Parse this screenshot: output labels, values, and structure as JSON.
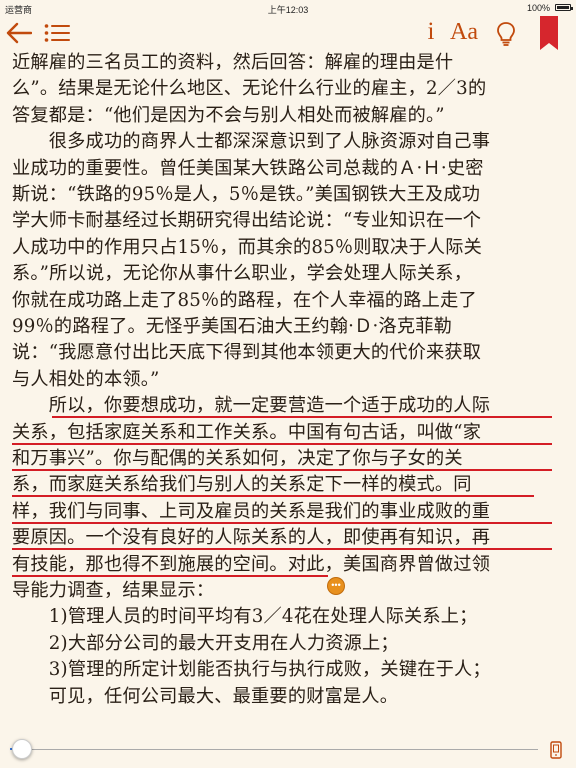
{
  "status_bar": {
    "carrier": "运营商",
    "time": "上午12:03",
    "battery": "100%"
  },
  "toolbar": {
    "info_label": "i",
    "font_label": "Aa"
  },
  "reading": {
    "progress": 0.02,
    "note_label": "•••",
    "lines": [
      "近解雇的三名员工的资料，然后回答：解雇的理由是什",
      "么”。结果是无论什么地区、无论什么行业的雇主，2／3的",
      "答复都是：“他们是因为不会与别人相处而被解雇的。”",
      "　　很多成功的商界人士都深深意识到了人脉资源对自己事",
      "业成功的重要性。曾任美国某大铁路公司总裁的Ａ·Ｈ·史密",
      "斯说：“铁路的95％是人，5％是铁。”美国钢铁大王及成功",
      "学大师卡耐基经过长期研究得出结论说：“专业知识在一个",
      "人成功中的作用只占15％，而其余的85％则取决于人际关",
      "系。”所以说，无论你从事什么职业，学会处理人际关系，",
      "你就在成功路上走了85％的路程，在个人幸福的路上走了",
      "99％的路程了。无怪乎美国石油大王约翰·Ｄ·洛克菲勒",
      "说：“我愿意付出比天底下得到其他本领更大的代价来获取",
      "与人相处的本领。”",
      "　　所以，你要想成功，就一定要营造一个适于成功的人际",
      "关系，包括家庭关系和工作关系。中国有句古话，叫做“家",
      "和万事兴”。你与配偶的关系如何，决定了你与子女的关",
      "系，而家庭关系给我们与别人的关系定下一样的模式。同",
      "样，我们与同事、上司及雇员的关系是我们的事业成败的重",
      "要原因。一个没有良好的人际关系的人，即使再有知识，再",
      "有技能，那也得不到施展的空间。对此，美国商界曾做过领",
      "导能力调查，结果显示：",
      "　　1)管理人员的时间平均有3／4花在处理人际关系上；",
      "　　2)大部分公司的最大开支用在人力资源上；",
      "　　3)管理的所定计划能否执行与执行成败，关键在于人；",
      "　　可见，任何公司最大、最重要的财富是人。"
    ]
  }
}
